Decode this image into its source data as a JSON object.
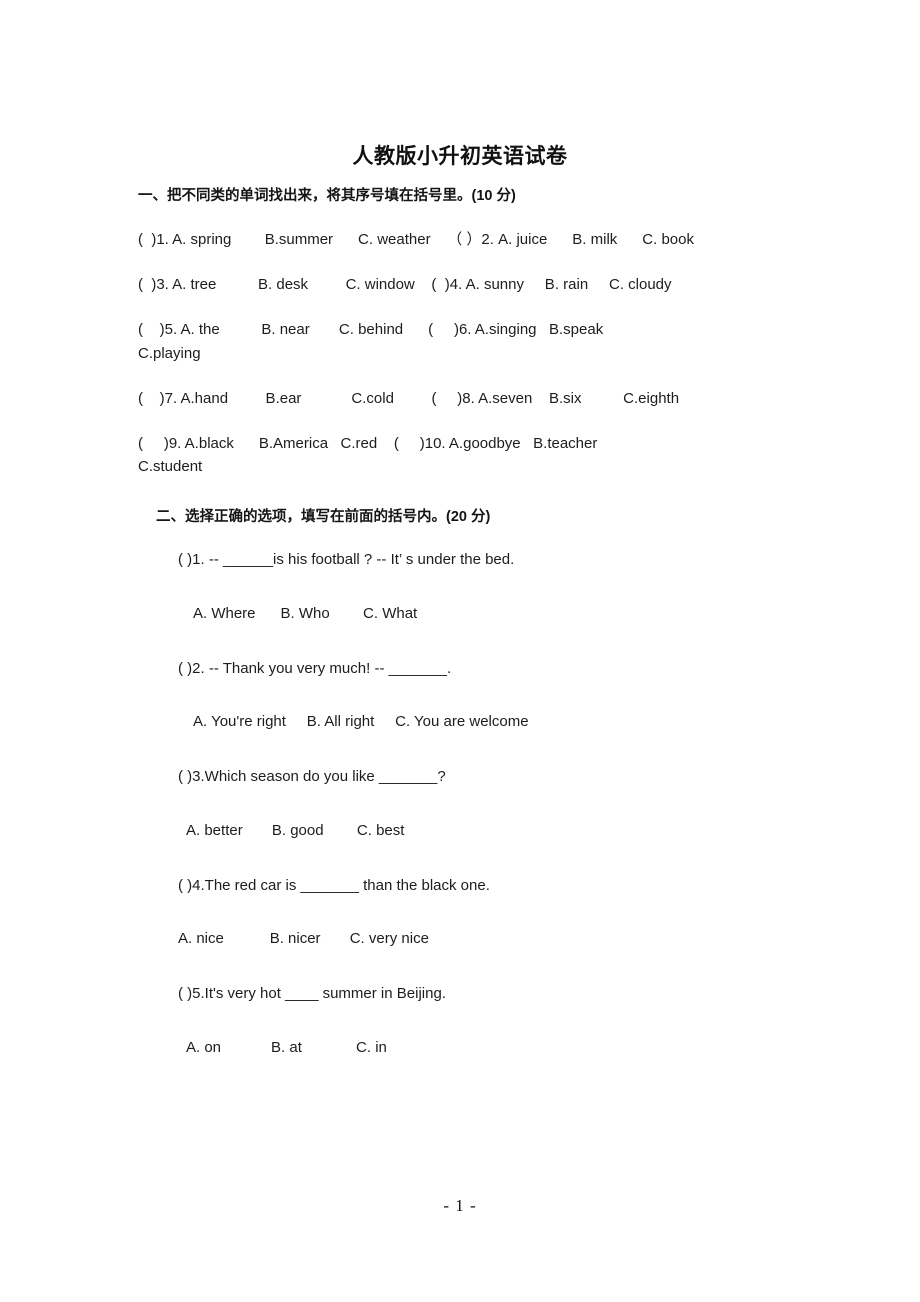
{
  "document": {
    "title": "人教版小升初英语试卷",
    "footer_page_label": "- 1 -"
  },
  "sections": [
    {
      "heading": "一、把不同类的单词找出来，将其序号填在括号里。(10 分)",
      "lines": [
        "(  )1. A. spring        B.summer      C. weather    （ ）2. A. juice      B. milk      C. book",
        "(  )3. A. tree          B. desk         C. window    (  )4. A. sunny     B. rain     C. cloudy",
        "(    )5. A. the          B. near       C. behind      (     )6. A.singing   B.speak\nC.playing",
        "(    )7. A.hand         B.ear            C.cold         (     )8. A.seven    B.six          C.eighth",
        "(     )9. A.black      B.America   C.red    (     )10. A.goodbye   B.teacher\nC.student"
      ]
    },
    {
      "heading": "二、选择正确的选项，填写在前面的括号内。(20 分)",
      "questions": [
        {
          "stem": "( )1. -- ______is his football ? -- It’ s under the bed.",
          "options": "A. Where      B. Who        C. What"
        },
        {
          "stem": "( )2. -- Thank you very much! -- _______.",
          "options": "A. You're right     B. All right     C. You are welcome"
        },
        {
          "stem": "( )3.Which season do you like _______?",
          "options": "A. better       B. good        C. best"
        },
        {
          "stem": "( )4.The red car is _______ than the black one.",
          "options": "A. nice           B. nicer       C. very nice"
        },
        {
          "stem": "( )5.It's very hot ____ summer in Beijing.",
          "options": "A. on            B. at             C. in"
        }
      ]
    }
  ]
}
